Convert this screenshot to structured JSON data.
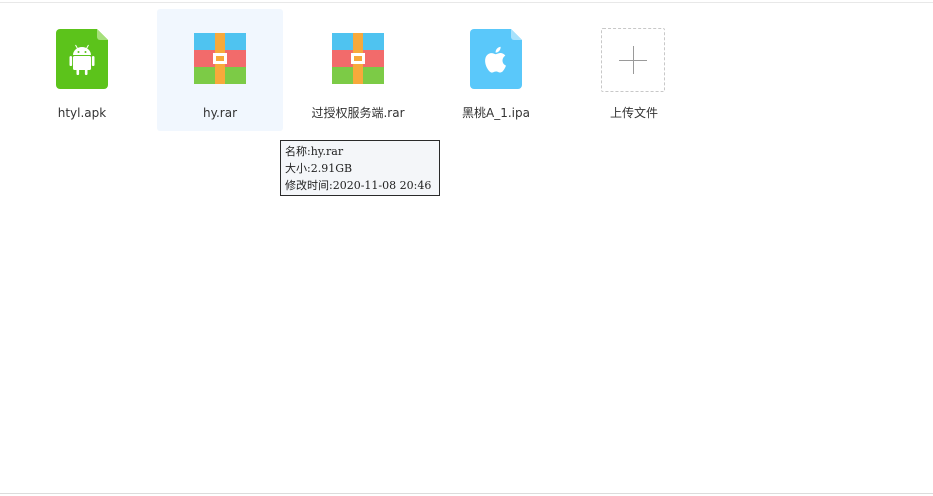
{
  "files": [
    {
      "name": "htyl.apk",
      "icon": "android-apk-icon"
    },
    {
      "name": "hy.rar",
      "icon": "rar-archive-icon"
    },
    {
      "name": "过授权服务端.rar",
      "icon": "rar-archive-icon"
    },
    {
      "name": "黑桃A_1.ipa",
      "icon": "apple-ipa-icon"
    }
  ],
  "upload": {
    "label": "上传文件",
    "icon": "plus-icon"
  },
  "tooltip": {
    "name": "名称:hy.rar",
    "size": "大小:2.91GB",
    "modified": "修改时间:2020-11-08 20:46"
  },
  "colors": {
    "apk_green": "#5cc31b",
    "ipa_blue": "#5ac8fa",
    "rar_red": "#f26b6b",
    "rar_cyan": "#4fc3f0",
    "rar_green": "#7ccb46",
    "rar_orange": "#f7a93b",
    "hover_bg": "#f1f7fe"
  }
}
